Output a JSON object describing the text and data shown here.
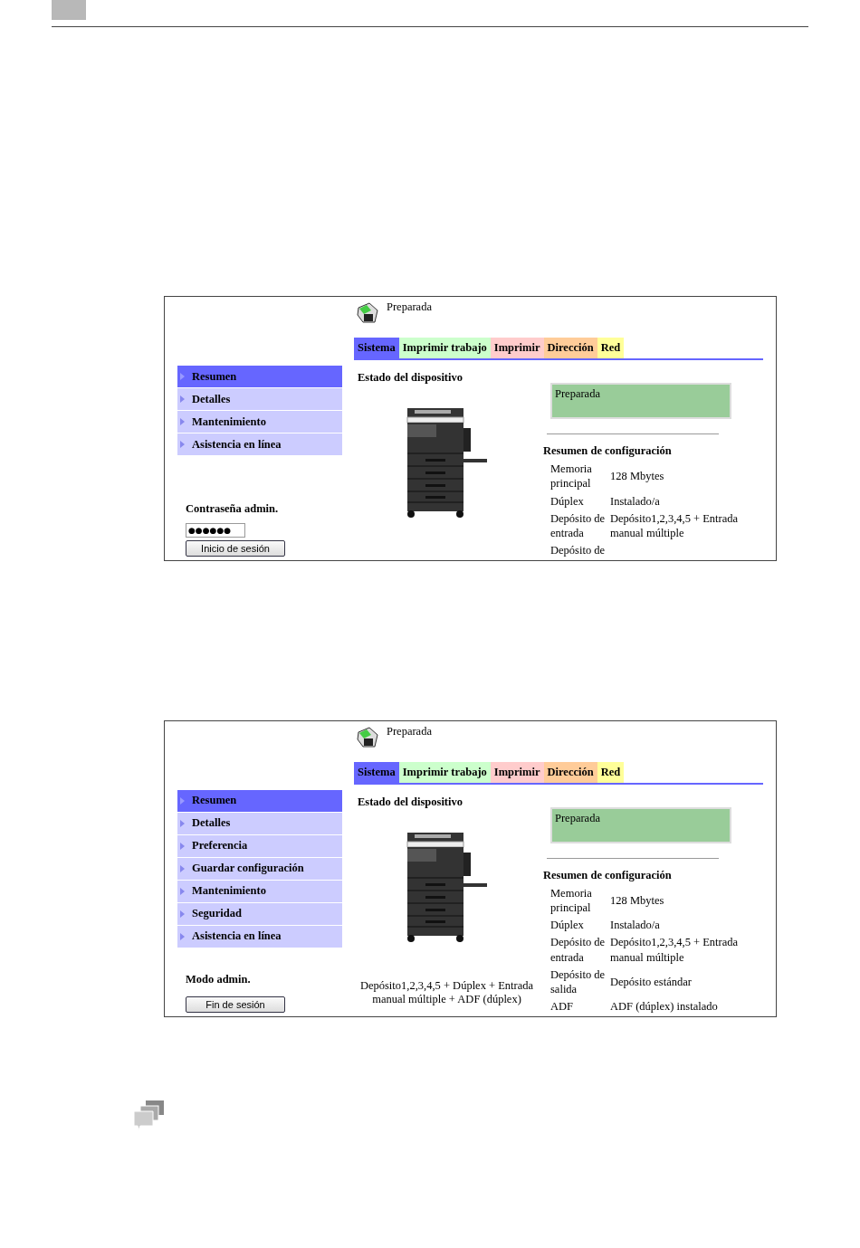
{
  "screenshots": [
    {
      "status_text": "Preparada",
      "tabs": [
        {
          "label": "Sistema",
          "color": "#6666ff"
        },
        {
          "label": "Imprimir trabajo",
          "color": "#ccffcc"
        },
        {
          "label": "Imprimir",
          "color": "#ffcccc"
        },
        {
          "label": "Dirección",
          "color": "#ffcc99"
        },
        {
          "label": "Red",
          "color": "#ffff99"
        }
      ],
      "sidebar": [
        {
          "label": "Resumen",
          "selected": true
        },
        {
          "label": "Detalles",
          "selected": false
        },
        {
          "label": "Mantenimiento",
          "selected": false
        },
        {
          "label": "Asistencia en línea",
          "selected": false
        }
      ],
      "section_title": "Estado del dispositivo",
      "status_box": "Preparada",
      "config_title": "Resumen de configuración",
      "config": [
        {
          "label": "Memoria principal",
          "value": "128 Mbytes"
        },
        {
          "label": "Dúplex",
          "value": "Instalado/a"
        },
        {
          "label": "Depósito de entrada",
          "value": "Depósito1,2,3,4,5 + Entrada manual múltiple"
        },
        {
          "label": "Depósito de"
        }
      ],
      "admin": {
        "label": "Contraseña admin.",
        "password": "●●●●●●",
        "button": "Inicio de sesión"
      }
    },
    {
      "status_text": "Preparada",
      "tabs": [
        {
          "label": "Sistema",
          "color": "#6666ff"
        },
        {
          "label": "Imprimir trabajo",
          "color": "#ccffcc"
        },
        {
          "label": "Imprimir",
          "color": "#ffcccc"
        },
        {
          "label": "Dirección",
          "color": "#ffcc99"
        },
        {
          "label": "Red",
          "color": "#ffff99"
        }
      ],
      "sidebar": [
        {
          "label": "Resumen",
          "selected": true
        },
        {
          "label": "Detalles",
          "selected": false
        },
        {
          "label": "Preferencia",
          "selected": false
        },
        {
          "label": "Guardar configuración",
          "selected": false
        },
        {
          "label": "Mantenimiento",
          "selected": false
        },
        {
          "label": "Seguridad",
          "selected": false
        },
        {
          "label": "Asistencia en línea",
          "selected": false
        }
      ],
      "section_title": "Estado del dispositivo",
      "status_box": "Preparada",
      "caption": "Depósito1,2,3,4,5 + Dúplex + Entrada manual múltiple + ADF (dúplex)",
      "config_title": "Resumen de configuración",
      "config": [
        {
          "label": "Memoria principal",
          "value": "128 Mbytes"
        },
        {
          "label": "Dúplex",
          "value": "Instalado/a"
        },
        {
          "label": "Depósito de entrada",
          "value": "Depósito1,2,3,4,5 + Entrada manual múltiple"
        },
        {
          "label": "Depósito de salida",
          "value": "Depósito estándar"
        },
        {
          "label": "ADF",
          "value": "ADF (dúplex) instalado"
        }
      ],
      "admin": {
        "label": "Modo admin.",
        "button": "Fin de sesión"
      }
    }
  ]
}
